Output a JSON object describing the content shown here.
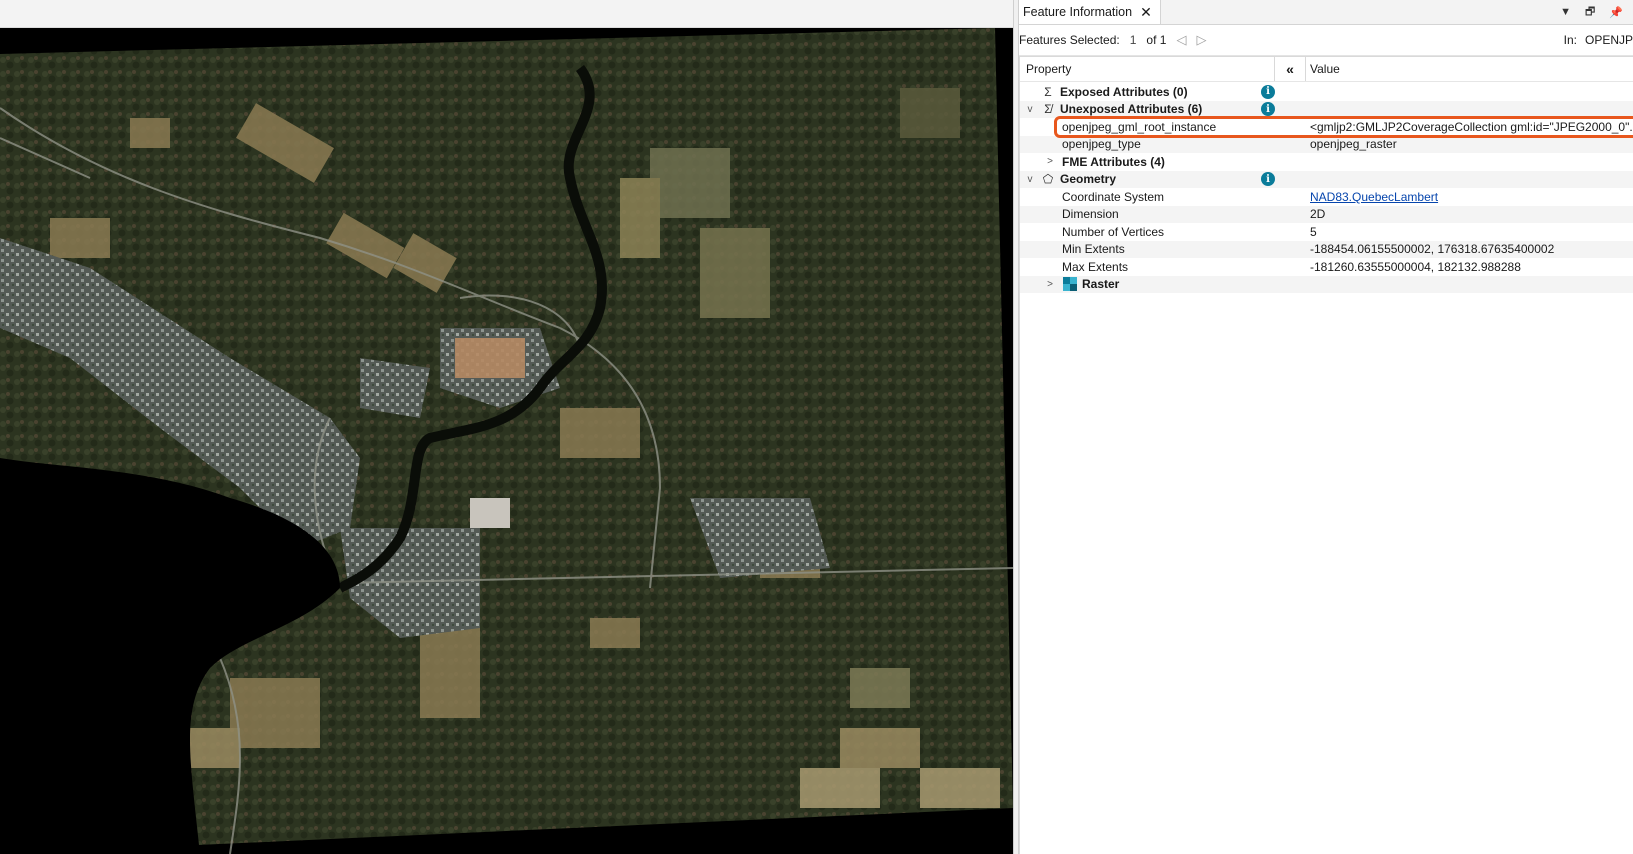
{
  "panel": {
    "tab_title": "Feature Information",
    "tab_close": "✕",
    "tab_controls": [
      "▼",
      "🗗",
      "📌"
    ],
    "toolbar": {
      "features_selected_label": "Features Selected:",
      "selected_count": "1",
      "of_total": "of 1",
      "prev_arrow": "◁",
      "next_arrow": "▷",
      "in_label": "In:",
      "in_value": "OPENJP"
    },
    "columns": {
      "property": "Property",
      "collapse": "«",
      "value": "Value"
    },
    "rows": [
      {
        "name": "Exposed Attributes (0)",
        "icon": "Σ",
        "twisty": "",
        "bold": true,
        "info": "i",
        "value": ""
      },
      {
        "name": "Unexposed Attributes (6)",
        "icon": "Σ̸",
        "twisty": "v",
        "bold": true,
        "info": "i",
        "value": ""
      },
      {
        "name": "openjpeg_gml_root_instance",
        "value": "<gmljp2:GMLJP2CoverageCollection gml:id=\"JPEG2000_0\"..."
      },
      {
        "name": "openjpeg_type",
        "value": "openjpeg_raster"
      },
      {
        "name": "FME Attributes (4)",
        "twisty": ">",
        "bold": true,
        "value": ""
      },
      {
        "name": "Geometry",
        "icon": "⬠",
        "twisty": "v",
        "bold": true,
        "info": "i",
        "value": ""
      },
      {
        "name": "Coordinate System",
        "value": "NAD83.QuebecLambert",
        "link": true
      },
      {
        "name": "Dimension",
        "value": "2D"
      },
      {
        "name": "Number of Vertices",
        "value": "5"
      },
      {
        "name": "Min Extents",
        "value": "-188454.06155500002, 176318.67635400002"
      },
      {
        "name": "Max Extents",
        "value": "-181260.63555000004, 182132.988288"
      },
      {
        "name": "Raster",
        "twisty": ">",
        "bold": true,
        "icon": "raster",
        "value": ""
      }
    ]
  },
  "colors": {
    "accent_info": "#0b7c9a",
    "highlight": "#e8571d",
    "link": "#0645ad"
  }
}
